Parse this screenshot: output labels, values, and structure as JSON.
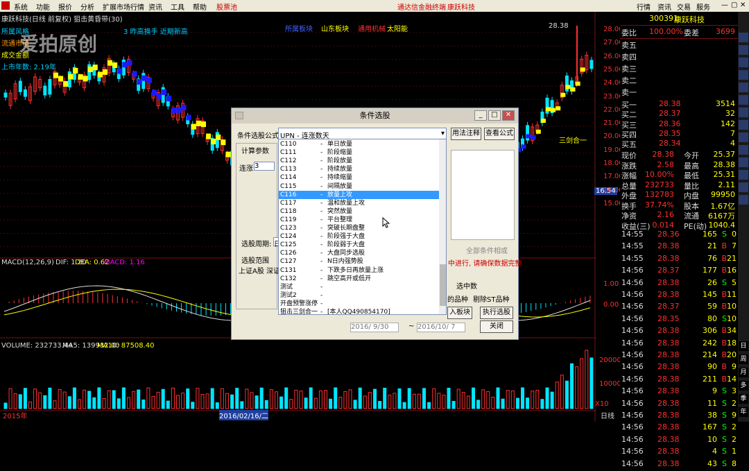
{
  "menu": {
    "items": [
      "系统",
      "功能",
      "报价",
      "分析",
      "扩展市场行情",
      "资讯",
      "工具",
      "帮助",
      "股票池"
    ],
    "center_items": [
      "通达信金融终端",
      "康跃科技"
    ],
    "right_items": [
      "行情",
      "资讯",
      "交易",
      "服务"
    ]
  },
  "chart_title": "康跃科技(日线 前复权) 狙击黄昏带(30)",
  "overlay": {
    "row1": "所属风格",
    "row2": "流通市值",
    "row3": "成交金额",
    "row4": "上市年数: 2.19年",
    "tag1": "所属板块",
    "tag2": "山东板块",
    "tag3": "通用机械",
    "tag4": "太阳能",
    "tag5": "3 昨高换手 近期新高",
    "watermark": "爱拍原创"
  },
  "price_axis": {
    "labels": [
      "28.00",
      "27.00",
      "26.00",
      "25.00",
      "24.00",
      "23.00",
      "22.00",
      "21.00",
      "20.00",
      "19.00",
      "18.00",
      "17.00",
      "16.00",
      "15.00"
    ],
    "high": "28.38",
    "current": "16.54",
    "annot": "三剑合一"
  },
  "macd": {
    "label": "MACD(12,26,9)",
    "dif": "DIF: 1.20",
    "dea": "DEA: 0.62",
    "macd": "MACD: 1.16",
    "axis": [
      "1.00",
      "0.00"
    ]
  },
  "volume": {
    "label": "VOLUME: 232733.44",
    "ma5": "MA5: 139932.00",
    "ma10": "MA10: 87508.40",
    "axis": [
      "20000",
      "10000"
    ],
    "unit": "X10"
  },
  "x_axis": {
    "start": "2015年",
    "mid": "2016/02/16/二",
    "period": "日线"
  },
  "bottom_right": "14:56",
  "quote": {
    "code": "300391",
    "name": "康跃科技",
    "webi": "委比",
    "webi_v": "100.00%",
    "wecha": "委差",
    "wecha_v": "3699",
    "sell": [
      {
        "l": "卖五",
        "p": "",
        "v": ""
      },
      {
        "l": "卖四",
        "p": "",
        "v": ""
      },
      {
        "l": "卖三",
        "p": "",
        "v": ""
      },
      {
        "l": "卖二",
        "p": "",
        "v": ""
      },
      {
        "l": "卖一",
        "p": "",
        "v": ""
      }
    ],
    "buy": [
      {
        "l": "买一",
        "p": "28.38",
        "v": "3514"
      },
      {
        "l": "买二",
        "p": "28.37",
        "v": "32"
      },
      {
        "l": "买三",
        "p": "28.36",
        "v": "142"
      },
      {
        "l": "买四",
        "p": "28.35",
        "v": "7"
      },
      {
        "l": "买五",
        "p": "28.34",
        "v": "4"
      }
    ],
    "stats": [
      [
        "现价",
        "28.38",
        "今开",
        "25.37"
      ],
      [
        "涨跌",
        "2.58",
        "最高",
        "28.38"
      ],
      [
        "涨幅",
        "10.00%",
        "最低",
        "25.31"
      ],
      [
        "总量",
        "232733",
        "量比",
        "2.11"
      ],
      [
        "外盘",
        "132783",
        "内盘",
        "99950"
      ],
      [
        "换手",
        "37.74%",
        "股本",
        "1.67亿"
      ],
      [
        "净资",
        "2.16",
        "流通",
        "6167万"
      ],
      [
        "收益(三)",
        "0.014",
        "PE(动)",
        "1040.4"
      ]
    ]
  },
  "ticks": [
    [
      "14:55",
      "28.36",
      "165",
      "S",
      "0"
    ],
    [
      "14:55",
      "28.38",
      "21",
      "B",
      "7"
    ],
    [
      "14:55",
      "28.38",
      "76",
      "B",
      "21"
    ],
    [
      "14:56",
      "28.37",
      "177",
      "B",
      "16"
    ],
    [
      "14:56",
      "28.38",
      "26",
      "S",
      "5"
    ],
    [
      "14:56",
      "28.38",
      "145",
      "B",
      "11"
    ],
    [
      "14:56",
      "28.37",
      "59",
      "B",
      "10"
    ],
    [
      "14:56",
      "28.35",
      "80",
      "S",
      "10"
    ],
    [
      "14:56",
      "28.38",
      "306",
      "B",
      "34"
    ],
    [
      "14:56",
      "28.38",
      "242",
      "B",
      "18"
    ],
    [
      "14:56",
      "28.38",
      "214",
      "B",
      "20"
    ],
    [
      "14:56",
      "28.38",
      "90",
      "B",
      "9"
    ],
    [
      "14:56",
      "28.38",
      "211",
      "B",
      "14"
    ],
    [
      "14:56",
      "28.38",
      "9",
      "S",
      "3"
    ],
    [
      "14:56",
      "28.38",
      "11",
      "S",
      "2"
    ],
    [
      "14:56",
      "28.38",
      "38",
      "S",
      "9"
    ],
    [
      "14:56",
      "28.38",
      "167",
      "S",
      "2"
    ],
    [
      "14:56",
      "28.38",
      "10",
      "S",
      "2"
    ],
    [
      "14:56",
      "28.38",
      "4",
      "S",
      "1"
    ],
    [
      "14:56",
      "28.38",
      "43",
      "S",
      "8"
    ]
  ],
  "sidebar": [
    "行情",
    "资讯",
    "交易",
    "服务",
    "日",
    "周",
    "月",
    "多",
    "季",
    "年"
  ],
  "dialog": {
    "title": "条件选股",
    "formula_label": "条件选股公式",
    "selected": "UPN  -  连涨数天",
    "btn_use": "用法注释",
    "btn_view": "查看公式",
    "calc_params": "计算参数",
    "param_lbl": "连涨",
    "param_val": "3",
    "period_lbl": "选股周期:",
    "period_val": "日",
    "scope": "选股范围",
    "scope_items": "上证A股  深证",
    "status": "中进行, 请确保数据完整",
    "all_cond": "全部条件相或",
    "sel_count": "选中数",
    "st_chk": "剔除ST品种",
    "var_chk": "的品种",
    "btn_add": "入板块",
    "btn_exec": "执行选股",
    "btn_close": "关闭",
    "date1": "2016/ 9/30",
    "date2": "2016/10/ 7",
    "list": [
      [
        "C110",
        "单日放量"
      ],
      [
        "C111",
        "阶段缩量"
      ],
      [
        "C112",
        "阶段放量"
      ],
      [
        "C113",
        "持续放量"
      ],
      [
        "C114",
        "持续缩量"
      ],
      [
        "C115",
        "间隔放量"
      ],
      [
        "C116",
        "放量上攻"
      ],
      [
        "C117",
        "温和放量上攻"
      ],
      [
        "C118",
        "突然放量"
      ],
      [
        "C119",
        "平台整理"
      ],
      [
        "C123",
        "突破长期盘整"
      ],
      [
        "C124",
        "阶段强于大盘"
      ],
      [
        "C125",
        "阶段弱于大盘"
      ],
      [
        "C126",
        "大盘同步选股"
      ],
      [
        "C127",
        "N日内强势股"
      ],
      [
        "C131",
        "下跌多日再放量上涨"
      ],
      [
        "C132",
        "跳空高开或低开"
      ],
      [
        "测试",
        ""
      ],
      [
        "测试2",
        ""
      ],
      [
        "开盘预警涨停",
        ""
      ],
      [
        "狙击三剑合一",
        "[本人QQ490854170]"
      ]
    ]
  },
  "colors": {
    "up": "#ff3030",
    "down": "#00e5ff",
    "yellow": "#ffff00",
    "blue": "#1a1aff",
    "grid": "#7a1010"
  }
}
